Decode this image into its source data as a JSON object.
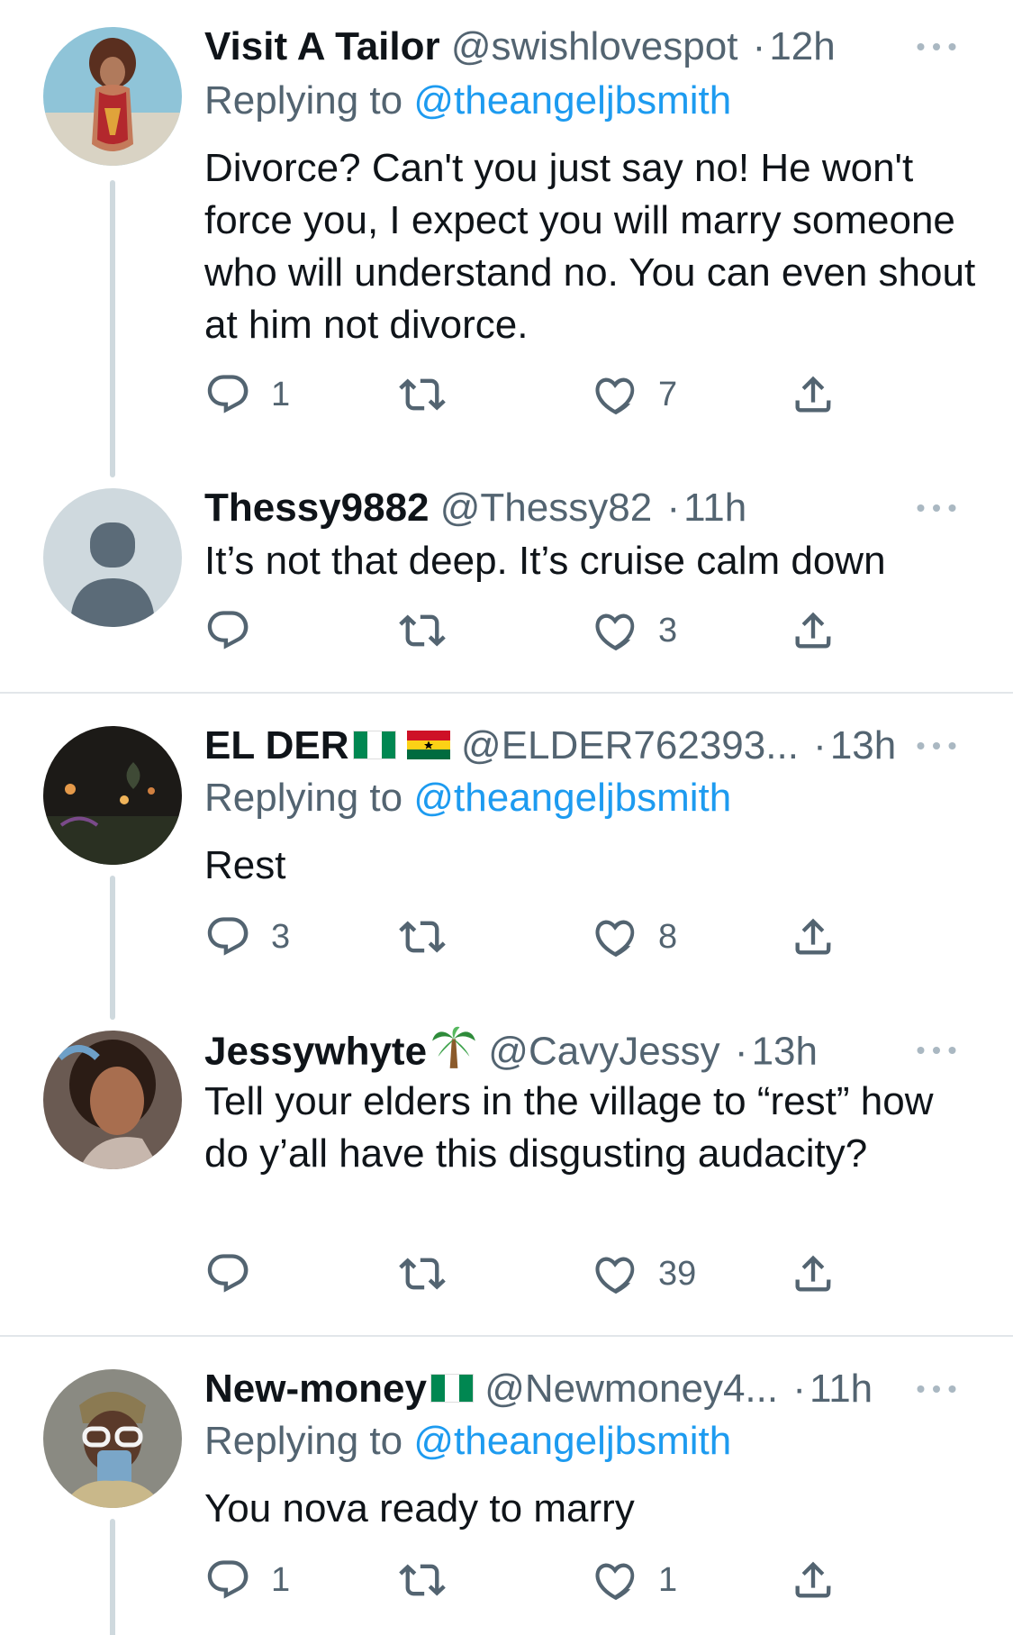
{
  "colors": {
    "link": "#1d9bf0",
    "muted": "#536471",
    "text": "#0f1419",
    "thread_line": "#cfd9de"
  },
  "replying_prefix": "Replying to",
  "tweets": [
    {
      "name": "Visit A Tailor",
      "handle": "@swishlovespot",
      "sep": "·",
      "time": "12h",
      "replying_to": "@theangeljbsmith",
      "text": "Divorce? Can't you just say no! He won't force you, I expect you will marry someone who will understand no. You can even shout at him not divorce.",
      "reply_count": "1",
      "retweet_count": "",
      "like_count": "7"
    },
    {
      "name": "Thessy9882",
      "handle": "@Thessy82",
      "sep": "·",
      "time": "11h",
      "text": "It’s not that deep. It’s cruise calm down",
      "reply_count": "",
      "retweet_count": "",
      "like_count": "3"
    },
    {
      "name": "EL DER",
      "name_emoji": [
        "nigeria-flag",
        "ghana-flag"
      ],
      "handle": "@ELDER762393...",
      "sep": "·",
      "time": "13h",
      "replying_to": "@theangeljbsmith",
      "text": "Rest",
      "reply_count": "3",
      "retweet_count": "",
      "like_count": "8"
    },
    {
      "name": "Jessywhyte",
      "name_emoji": [
        "palm-tree"
      ],
      "handle": "@CavyJessy",
      "sep": "·",
      "time": "13h",
      "text": "Tell your elders in the village to “rest” how do y’all have this disgusting audacity?",
      "reply_count": "",
      "retweet_count": "",
      "like_count": "39"
    },
    {
      "name": "New-money",
      "name_emoji": [
        "nigeria-flag"
      ],
      "handle": "@Newmoney4...",
      "sep": "·",
      "time": "11h",
      "replying_to": "@theangeljbsmith",
      "text": "You nova ready to marry",
      "reply_count": "1",
      "retweet_count": "",
      "like_count": "1"
    }
  ]
}
